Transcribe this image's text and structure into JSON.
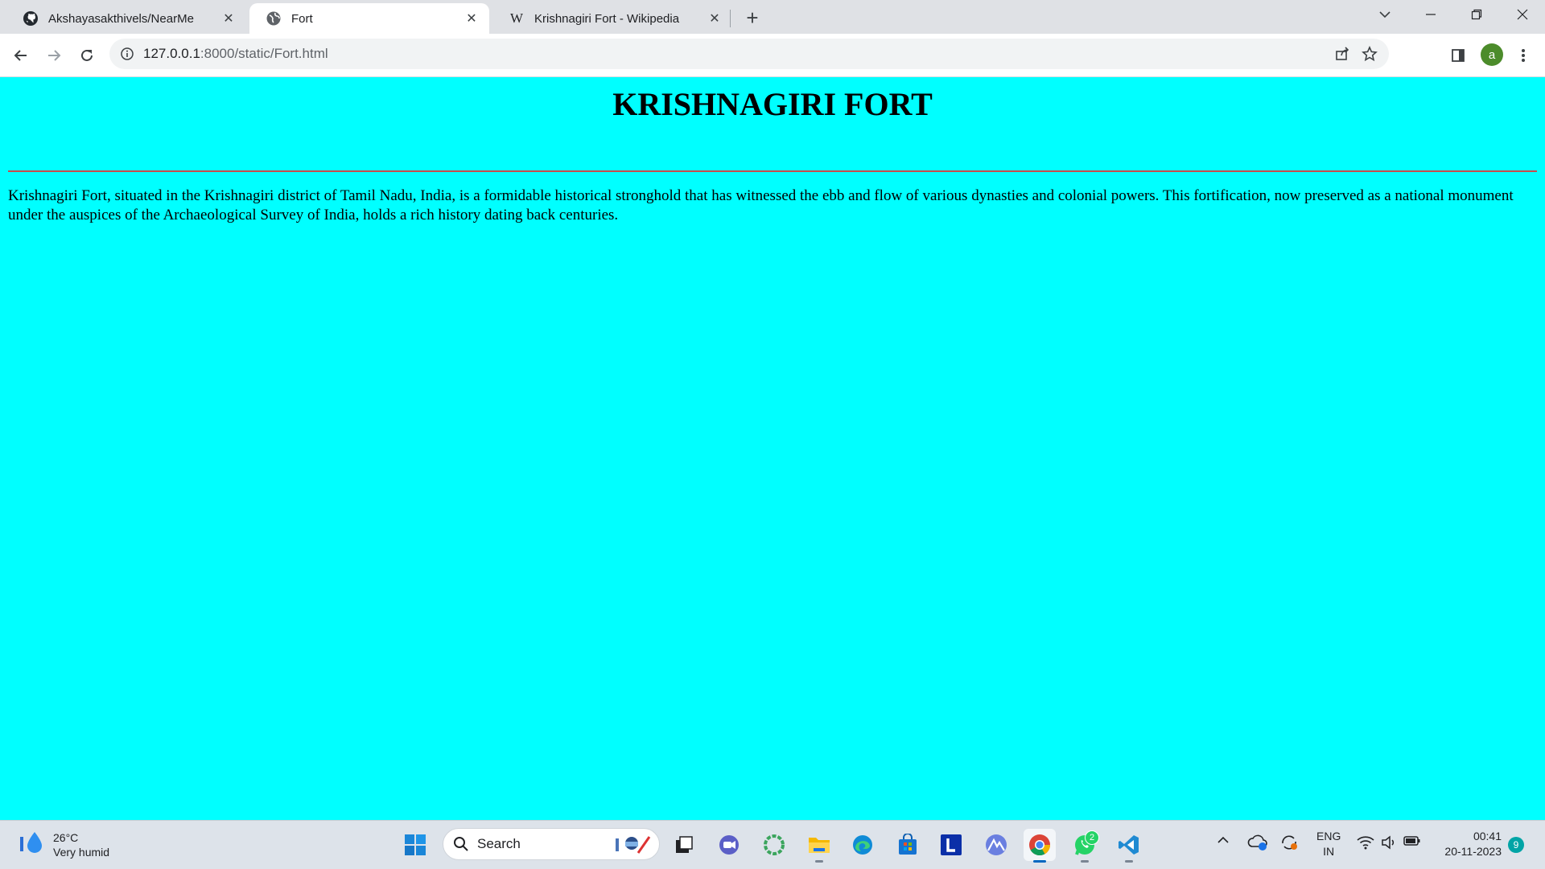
{
  "browser": {
    "tabs": [
      {
        "label": "Akshayasakthivels/NearMe",
        "icon": "github-icon",
        "active": false
      },
      {
        "label": "Fort",
        "icon": "globe-icon",
        "active": true
      },
      {
        "label": "Krishnagiri Fort - Wikipedia",
        "icon": "wikipedia-icon",
        "active": false
      }
    ],
    "url_host": "127.0.0.1",
    "url_rest": ":8000/static/Fort.html",
    "profile_initial": "a"
  },
  "page": {
    "title": "KRISHNAGIRI FORT",
    "paragraph": "Krishnagiri Fort, situated in the Krishnagiri district of Tamil Nadu, India, is a formidable historical stronghold that has witnessed the ebb and flow of various dynasties and colonial powers. This fortification, now preserved as a national monument under the auspices of the Archaeological Survey of India, holds a rich history dating back centuries.",
    "background_color": "#00ffff",
    "rule_color": "#c84b4b"
  },
  "taskbar": {
    "weather_temp": "26°C",
    "weather_desc": "Very humid",
    "search_label": "Search",
    "whatsapp_badge": "2",
    "lang_line1": "ENG",
    "lang_line2": "IN",
    "time": "00:41",
    "date": "20-11-2023",
    "notification_count": "9"
  }
}
